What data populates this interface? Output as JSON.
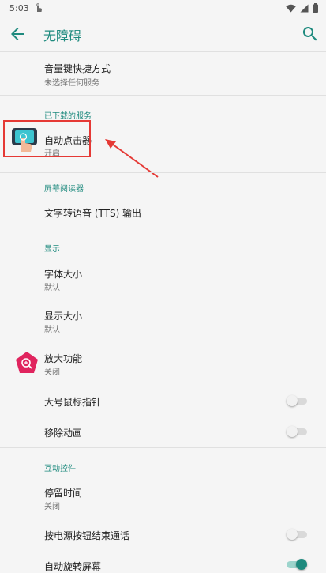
{
  "status": {
    "time": "5:03"
  },
  "appbar": {
    "title": "无障碍"
  },
  "items": {
    "volume_shortcut": {
      "title": "音量键快捷方式",
      "subtitle": "未选择任何服务"
    },
    "sec_downloaded": "已下载的服务",
    "auto_clicker": {
      "title": "自动点击器",
      "subtitle": "开启"
    },
    "sec_screen_reader": "屏幕阅读器",
    "tts": {
      "title": "文字转语音 (TTS) 输出"
    },
    "sec_display": "显示",
    "font_size": {
      "title": "字体大小",
      "subtitle": "默认"
    },
    "display_size": {
      "title": "显示大小",
      "subtitle": "默认"
    },
    "magnify": {
      "title": "放大功能",
      "subtitle": "关闭"
    },
    "large_pointer": {
      "title": "大号鼠标指针",
      "toggle": "off"
    },
    "remove_anim": {
      "title": "移除动画",
      "toggle": "off"
    },
    "sec_interaction": "互动控件",
    "dwell": {
      "title": "停留时间",
      "subtitle": "关闭"
    },
    "power_end_call": {
      "title": "按电源按钮结束通话",
      "toggle": "off"
    },
    "auto_rotate": {
      "title": "自动旋转屏幕",
      "toggle": "on"
    }
  },
  "colors": {
    "accent": "#1e8a7e",
    "highlight": "#e53935",
    "magnify_icon": "#e0245e"
  }
}
